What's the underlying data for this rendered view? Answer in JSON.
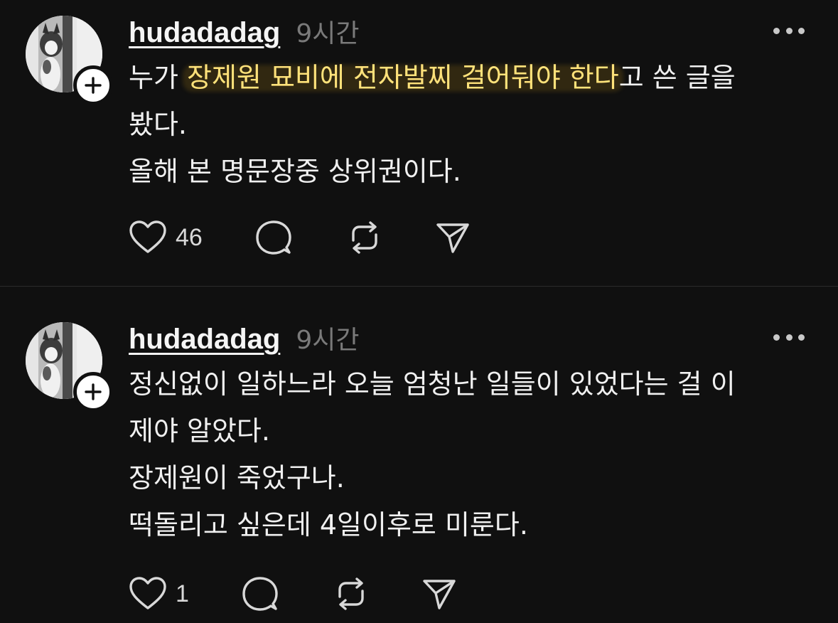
{
  "posts": [
    {
      "username": "hudadadag",
      "time": "9시간",
      "lines": [
        {
          "pre": "누가 ",
          "highlight": "장제원 묘비에 전자발찌 걸어둬야 한다",
          "post": "고 쓴 글을"
        },
        {
          "pre": "봤다.",
          "highlight": "",
          "post": ""
        },
        {
          "pre": "올해 본 명문장중 상위권이다.",
          "highlight": "",
          "post": ""
        }
      ],
      "likes": "46",
      "icons": {
        "like": "heart-icon",
        "reply": "comment-icon",
        "repost": "repost-icon",
        "share": "send-icon",
        "more": "more-icon",
        "follow": "plus-icon"
      }
    },
    {
      "username": "hudadadag",
      "time": "9시간",
      "lines": [
        "정신없이 일하느라 오늘 엄청난 일들이 있었다는 걸 이",
        "제야 알았다.",
        "장제원이 죽었구나.",
        "떡돌리고 싶은데 4일이후로 미룬다."
      ],
      "likes": "1",
      "icons": {
        "like": "heart-icon",
        "reply": "comment-icon",
        "repost": "repost-icon",
        "share": "send-icon",
        "more": "more-icon",
        "follow": "plus-icon"
      }
    }
  ],
  "colors": {
    "background": "#101010",
    "text": "#f0f0f0",
    "muted": "#7a7a7a",
    "highlight": "#ffe27a"
  }
}
